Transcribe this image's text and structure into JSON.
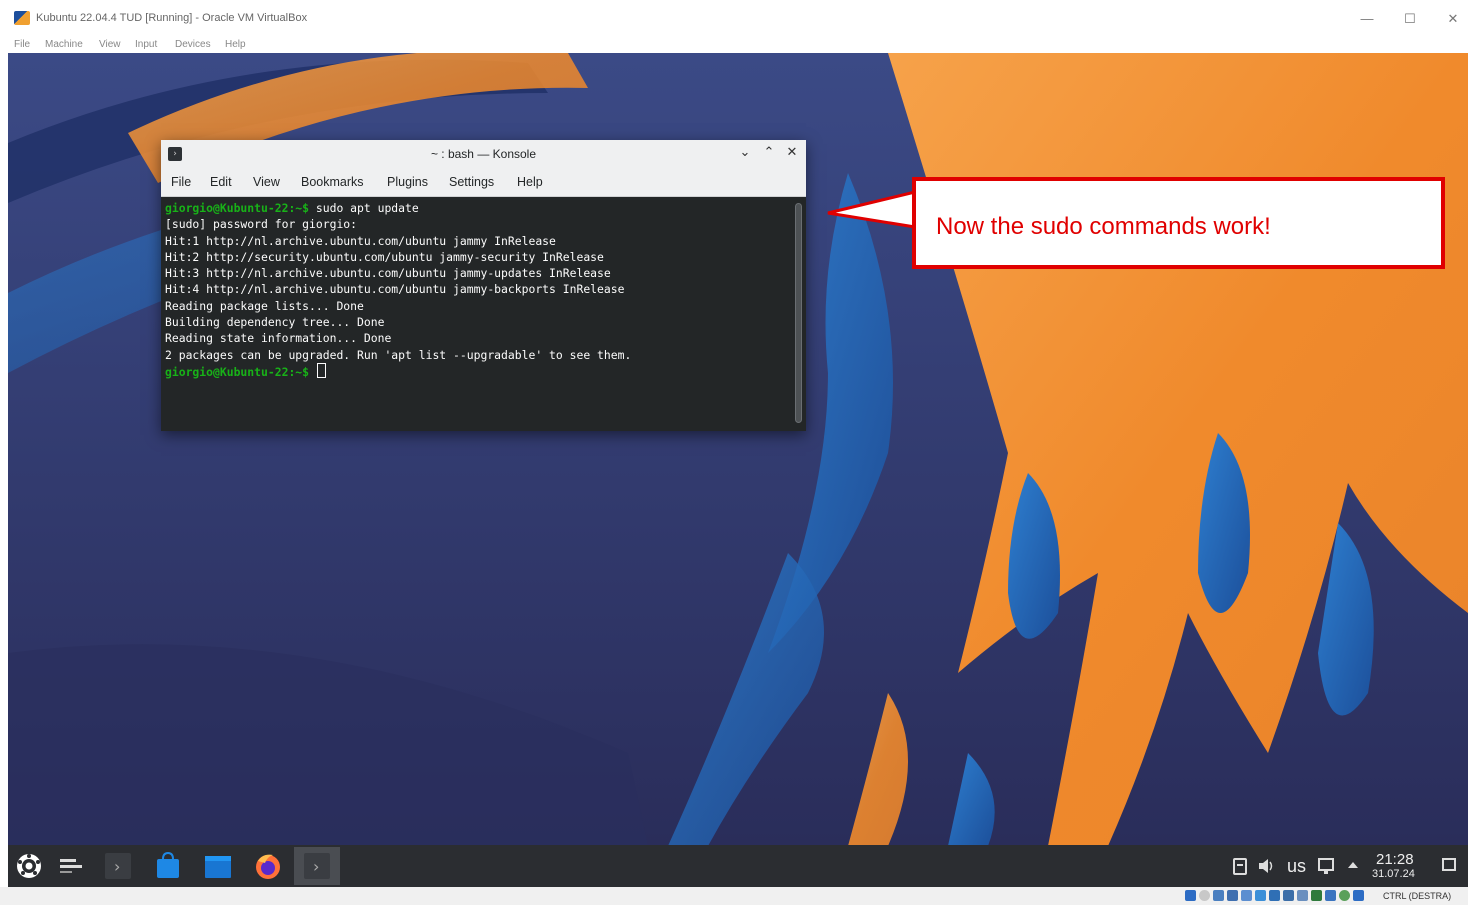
{
  "vbox": {
    "title": "Kubuntu 22.04.4 TUD [Running] - Oracle VM VirtualBox",
    "menu": [
      "File",
      "Machine",
      "View",
      "Input",
      "Devices",
      "Help"
    ],
    "controls": {
      "minimize": "—",
      "maximize": "☐",
      "close": "✕"
    },
    "status_hostkey": "CTRL (DESTRA)"
  },
  "konsole": {
    "title": "~ : bash — Konsole",
    "controls": {
      "minimize": "⌄",
      "maximize": "⌃",
      "close": "✕"
    },
    "menu": [
      "File",
      "Edit",
      "View",
      "Bookmarks",
      "Plugins",
      "Settings",
      "Help"
    ],
    "prompt": "giorgio@Kubuntu-22:~$",
    "command": " sudo apt update",
    "output": [
      "[sudo] password for giorgio:",
      "Hit:1 http://nl.archive.ubuntu.com/ubuntu jammy InRelease",
      "Hit:2 http://security.ubuntu.com/ubuntu jammy-security InRelease",
      "Hit:3 http://nl.archive.ubuntu.com/ubuntu jammy-updates InRelease",
      "Hit:4 http://nl.archive.ubuntu.com/ubuntu jammy-backports InRelease",
      "Reading package lists... Done",
      "Building dependency tree... Done",
      "Reading state information... Done",
      "2 packages can be upgraded. Run 'apt list --upgradable' to see them."
    ],
    "final_prompt": "giorgio@Kubuntu-22:~$"
  },
  "callout": {
    "text": "Now the sudo commands work!"
  },
  "taskbar": {
    "keyboard_layout": "us",
    "time": "21:28",
    "date": "31.07.24"
  },
  "colors": {
    "accent": "#e00000",
    "prompt": "#18b218",
    "terminal_bg": "#232627"
  }
}
